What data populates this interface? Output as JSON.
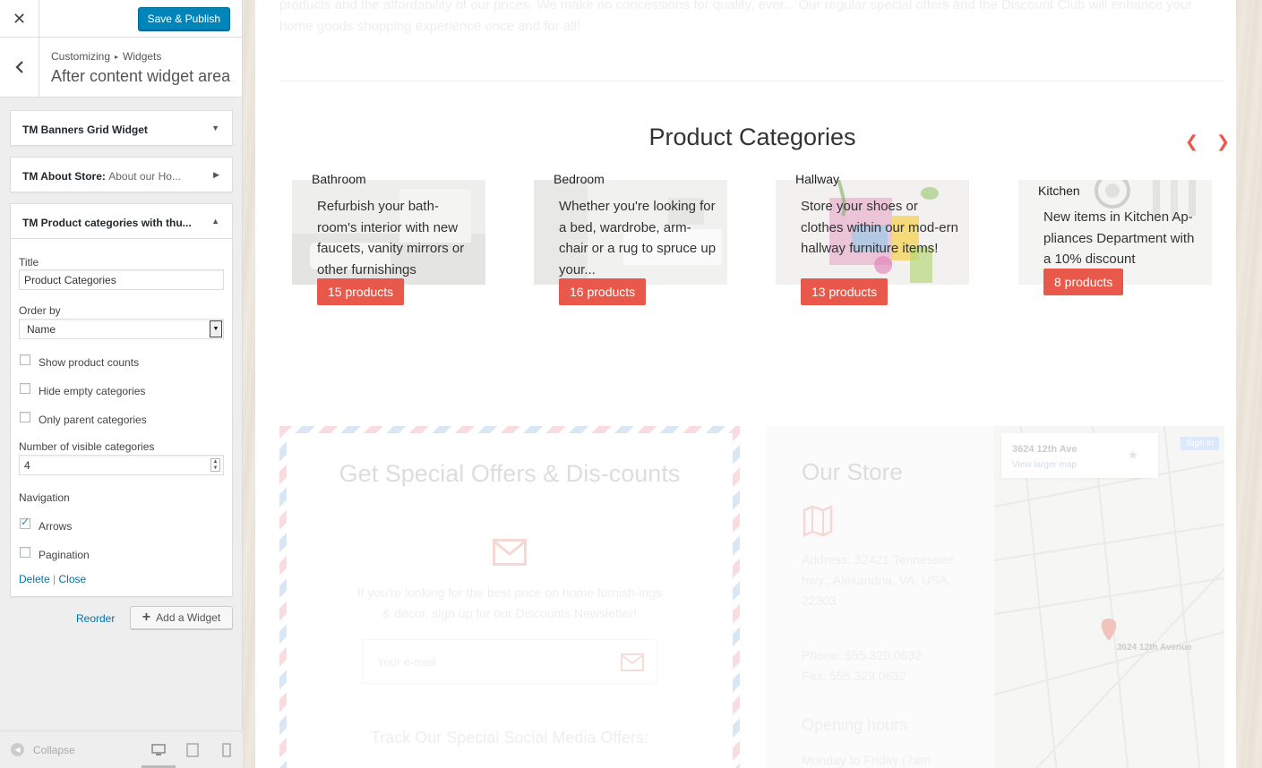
{
  "sidebar": {
    "publish_label": "Save & Publish",
    "breadcrumb": [
      "Customizing",
      "Widgets"
    ],
    "section_title": "After content widget area",
    "widgets": [
      {
        "title": "TM Banners Grid Widget",
        "subtitle": ""
      },
      {
        "title": "TM About Store:",
        "subtitle": "About our Ho..."
      },
      {
        "title": "TM Product categories with thu...",
        "subtitle": ""
      }
    ],
    "form": {
      "title_label": "Title",
      "title_value": "Product Categories",
      "order_label": "Order by",
      "order_value": "Name",
      "show_counts": "Show product counts",
      "hide_empty": "Hide empty categories",
      "only_parent": "Only parent categories",
      "visible_label": "Number of visible categories",
      "visible_value": "4",
      "nav_label": "Navigation",
      "arrows": "Arrows",
      "arrows_checked": true,
      "pagination": "Pagination",
      "pagination_checked": false,
      "delete": "Delete",
      "sep": "|",
      "close": "Close"
    },
    "reorder": "Reorder",
    "add_widget": "Add a Widget",
    "collapse": "Collapse"
  },
  "preview": {
    "intro": "products and the affordability of our prices. We make no concessions for quality, ever... Our regular special offers and the Discount Club will enhance your home goods shopping experience once and for all!",
    "section_title": "Product Categories",
    "categories": [
      {
        "name": "Bathroom",
        "desc": "Refurbish your bath-room's interior with new faucets, vanity mirrors or other furnishings",
        "count": "15 products"
      },
      {
        "name": "Bedroom",
        "desc": "Whether you're looking for a bed, wardrobe, arm-chair or a rug to spruce up your...",
        "count": "16 products"
      },
      {
        "name": "Hallway",
        "desc": "Store your shoes or clothes within our mod-ern hallway furniture items!",
        "count": "13 products"
      },
      {
        "name": "Kitchen",
        "desc": "New items in Kitchen Ap-pliances Department with a 10% discount",
        "count": "8 products"
      }
    ],
    "offers": {
      "title": "Get Special Offers & Dis-counts",
      "text": "If you're looking for the best price on home furnish-ings & decor, sign up for our Discounts Newsletter!",
      "email_placeholder": "Your e-mail",
      "track": "Track Our Special Social Media Offers:"
    },
    "store": {
      "title": "Our Store",
      "address": "Address: 32421 Tennessee hwy., Alexandria, VA, USA, 22303",
      "phone": "Phone: 555.329.0632",
      "fax": "Fax: 555.329.0632",
      "hours": "Opening hours",
      "hours_partial": "Monday to Friday (7am"
    },
    "map": {
      "address": "3624 12th Ave",
      "larger": "View larger map",
      "signin": "Sign in",
      "pin_label": "3624 12th Avenue"
    }
  },
  "colors": {
    "accent": "#e8594b",
    "wp_blue": "#0085ba",
    "link": "#0073aa"
  }
}
